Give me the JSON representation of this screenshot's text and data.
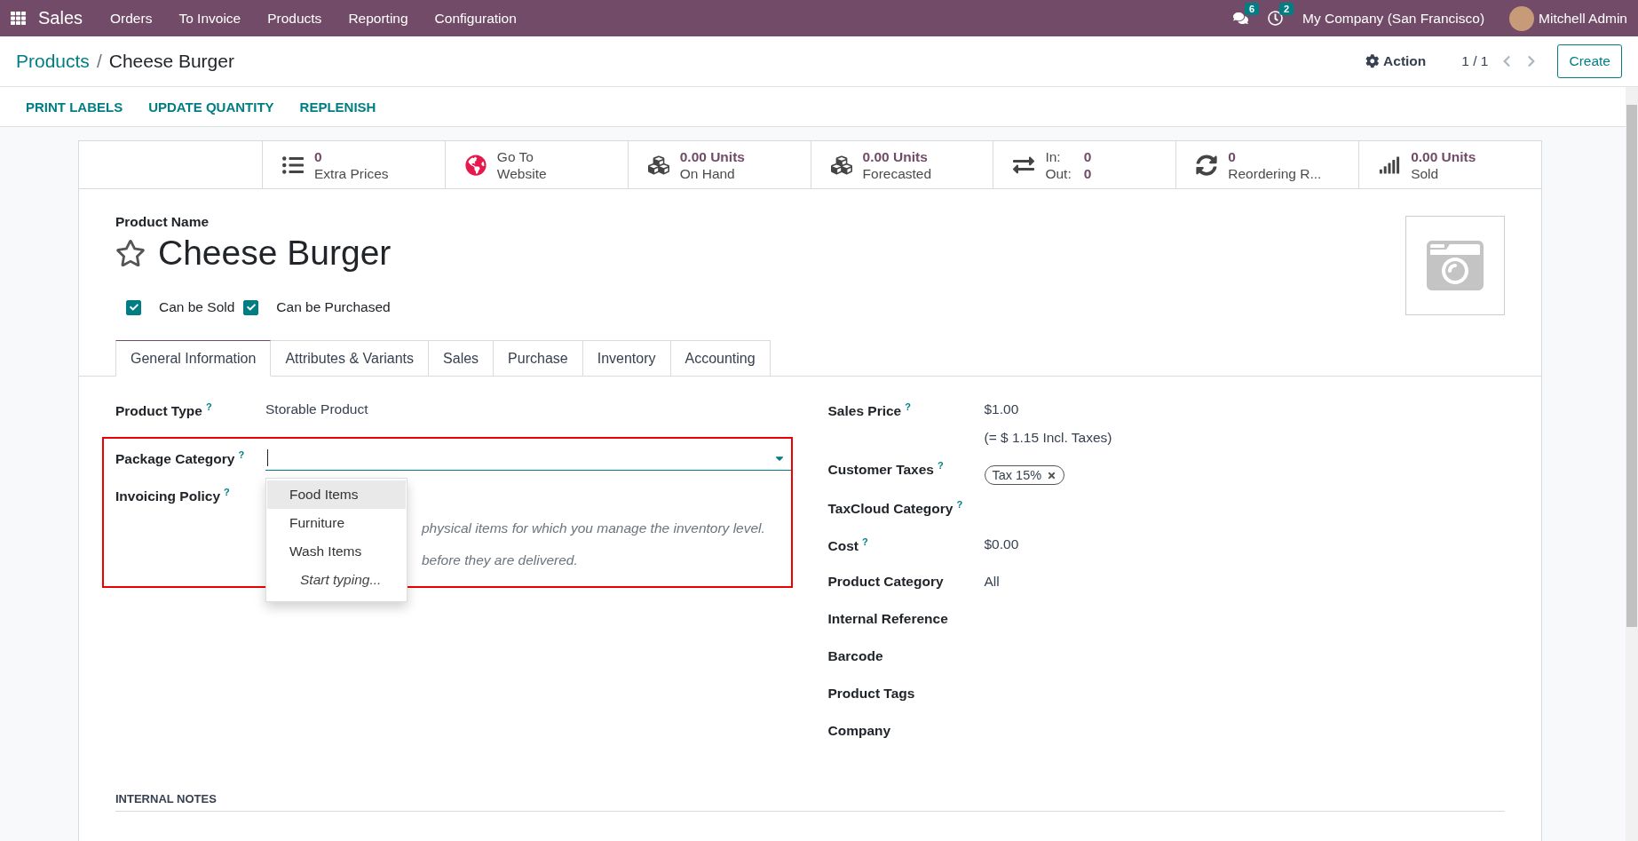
{
  "navbar": {
    "app": "Sales",
    "menu": [
      "Orders",
      "To Invoice",
      "Products",
      "Reporting",
      "Configuration"
    ],
    "messages_count": "6",
    "activities_count": "2",
    "company": "My Company (San Francisco)",
    "user": "Mitchell Admin"
  },
  "breadcrumb": {
    "parent": "Products",
    "separator": "/",
    "current": "Cheese Burger"
  },
  "control_panel": {
    "action": "Action",
    "pager": "1 / 1",
    "create": "Create"
  },
  "header_buttons": [
    "PRINT LABELS",
    "UPDATE QUANTITY",
    "REPLENISH"
  ],
  "stat_buttons": [
    {
      "kind": "stat",
      "value": "0",
      "label": "Extra Prices"
    },
    {
      "kind": "text",
      "line1": "Go To",
      "line2": "Website"
    },
    {
      "kind": "stat",
      "value": "0.00 Units",
      "label": "On Hand"
    },
    {
      "kind": "stat",
      "value": "0.00 Units",
      "label": "Forecasted"
    },
    {
      "kind": "inout",
      "in_label": "In:",
      "in_value": "0",
      "out_label": "Out:",
      "out_value": "0"
    },
    {
      "kind": "stat",
      "value": "0",
      "label": "Reordering R..."
    },
    {
      "kind": "stat",
      "value": "0.00 Units",
      "label": "Sold"
    }
  ],
  "product": {
    "name_label": "Product Name",
    "name": "Cheese Burger",
    "favorite": false,
    "checkboxes": [
      {
        "label": "Can be Sold",
        "checked": true
      },
      {
        "label": "Can be Purchased",
        "checked": true
      }
    ]
  },
  "tabs": [
    {
      "label": "General Information",
      "selected": true
    },
    {
      "label": "Attributes & Variants",
      "selected": false
    },
    {
      "label": "Sales",
      "selected": false
    },
    {
      "label": "Purchase",
      "selected": false
    },
    {
      "label": "Inventory",
      "selected": false
    },
    {
      "label": "Accounting",
      "selected": false
    }
  ],
  "left_fields": [
    {
      "kind": "text",
      "label": "Product Type",
      "help": "?",
      "value": "Storable Product"
    },
    {
      "kind": "input",
      "label": "Package Category",
      "help": "?",
      "focused": true
    },
    {
      "kind": "empty",
      "label": "Invoicing Policy",
      "help": "?"
    }
  ],
  "highlight_frame": true,
  "dropdown": {
    "options": [
      {
        "label": "Food Items",
        "selected": true
      },
      {
        "label": "Furniture",
        "selected": false
      },
      {
        "label": "Wash Items",
        "selected": false
      }
    ],
    "hint": "Start typing..."
  },
  "help_texts": [
    "physical items for which you manage the inventory level.",
    "before they are delivered."
  ],
  "right_fields": [
    {
      "kind": "text",
      "label": "Sales Price",
      "help": "?",
      "value": "$1.00",
      "note": "(= $ 1.15 Incl. Taxes)"
    },
    {
      "kind": "tag",
      "label": "Customer Taxes",
      "help": "?",
      "value": "Tax 15%"
    },
    {
      "kind": "empty",
      "label": "TaxCloud Category",
      "help": "?"
    },
    {
      "kind": "text",
      "label": "Cost",
      "help": "?",
      "value": "$0.00"
    },
    {
      "kind": "text",
      "label": "Product Category",
      "value": "All"
    },
    {
      "kind": "empty",
      "label": "Internal Reference"
    },
    {
      "kind": "empty",
      "label": "Barcode"
    },
    {
      "kind": "empty",
      "label": "Product Tags"
    },
    {
      "kind": "empty",
      "label": "Company"
    }
  ],
  "internal_notes": "INTERNAL NOTES"
}
